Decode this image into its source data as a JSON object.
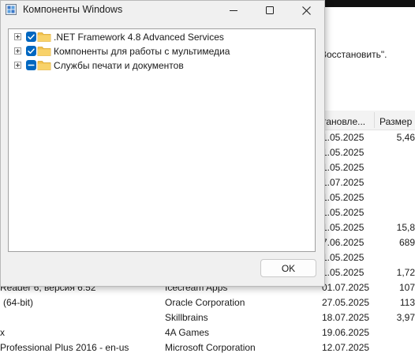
{
  "background_window": {
    "hint_text": "Восстановить\".",
    "columns": {
      "installed": "становле...",
      "size": "Размер"
    },
    "rows": [
      {
        "name": "",
        "publisher": "",
        "date": "1.05.2025",
        "size": "5,46"
      },
      {
        "name": "",
        "publisher": "",
        "date": "1.05.2025",
        "size": ""
      },
      {
        "name": "",
        "publisher": "",
        "date": "1.05.2025",
        "size": ""
      },
      {
        "name": "",
        "publisher": "",
        "date": "1.07.2025",
        "size": ""
      },
      {
        "name": "",
        "publisher": "",
        "date": "1.05.2025",
        "size": ""
      },
      {
        "name": "",
        "publisher": "",
        "date": "1.05.2025",
        "size": ""
      },
      {
        "name": "",
        "publisher": "",
        "date": "1.05.2025",
        "size": "15,8"
      },
      {
        "name": "",
        "publisher": "",
        "date": "7.06.2025",
        "size": "689"
      },
      {
        "name": "",
        "publisher": "",
        "date": "1.05.2025",
        "size": ""
      },
      {
        "name": "",
        "publisher": "",
        "date": "1.05.2025",
        "size": "1,72"
      },
      {
        "name": "Reader 6, версия 6.52",
        "publisher": "Icecream Apps",
        "date": "01.07.2025",
        "size": "107"
      },
      {
        "name": "(64-bit)",
        "publisher": "Oracle Corporation",
        "date": "27.05.2025",
        "size": "113"
      },
      {
        "name": "",
        "publisher": "Skillbrains",
        "date": "18.07.2025",
        "size": "3,97"
      },
      {
        "name": "x",
        "publisher": "4A Games",
        "date": "19.06.2025",
        "size": ""
      },
      {
        "name": "Professional Plus 2016 - en-us",
        "publisher": "Microsoft Corporation",
        "date": "12.07.2025",
        "size": ""
      }
    ]
  },
  "dialog": {
    "title": "Компоненты Windows",
    "icons": {
      "minimize": "minimize-icon",
      "maximize": "maximize-icon",
      "close": "close-icon"
    },
    "features": [
      {
        "label": ".NET Framework 4.8 Advanced Services",
        "state": "checked"
      },
      {
        "label": "Компоненты для работы с мультимедиа",
        "state": "checked"
      },
      {
        "label": "Службы печати и документов",
        "state": "partial"
      }
    ],
    "ok_label": "OK",
    "accent_color": "#0067c0",
    "folder_color": "#f4c542"
  }
}
